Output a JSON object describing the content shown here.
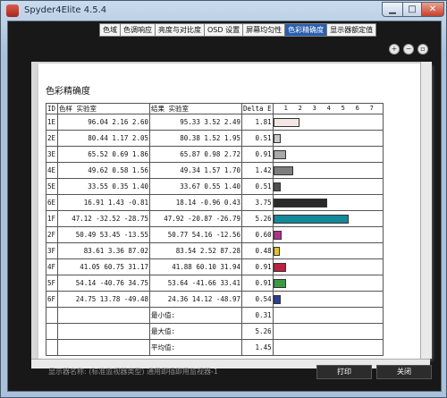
{
  "window": {
    "title": "Spyder4Elite 4.5.4"
  },
  "tabs": [
    "色域",
    "色调响应",
    "亮度与对比度",
    "OSD 设置",
    "屏幕均匀性",
    "色彩精确度",
    "显示器额定值"
  ],
  "active_tab": 5,
  "report": {
    "title": "色彩精确度",
    "headers": {
      "id": "ID",
      "sample": "色样 实验室",
      "result": "结果 实验室",
      "delta": "Delta E"
    },
    "scale_ticks": [
      "1",
      "2",
      "3",
      "4",
      "5",
      "6",
      "7"
    ],
    "rows": [
      {
        "id": "1E",
        "s": [
          "96.04",
          "2.16",
          "2.60"
        ],
        "r": [
          "95.33",
          "3.52",
          "2.49"
        ],
        "d": "1.81",
        "color": "#f4e6e2"
      },
      {
        "id": "2E",
        "s": [
          "80.44",
          "1.17",
          "2.05"
        ],
        "r": [
          "80.38",
          "1.52",
          "1.95"
        ],
        "d": "0.51",
        "color": "#c8c8c8"
      },
      {
        "id": "3E",
        "s": [
          "65.52",
          "0.69",
          "1.86"
        ],
        "r": [
          "65.87",
          "0.98",
          "2.72"
        ],
        "d": "0.91",
        "color": "#a8a8a8"
      },
      {
        "id": "4E",
        "s": [
          "49.62",
          "0.58",
          "1.56"
        ],
        "r": [
          "49.34",
          "1.57",
          "1.70"
        ],
        "d": "1.42",
        "color": "#7d7d7d"
      },
      {
        "id": "5E",
        "s": [
          "33.55",
          "0.35",
          "1.40"
        ],
        "r": [
          "33.67",
          "0.55",
          "1.40"
        ],
        "d": "0.51",
        "color": "#505050"
      },
      {
        "id": "6E",
        "s": [
          "16.91",
          "1.43",
          "-0.81"
        ],
        "r": [
          "18.14",
          "-0.96",
          "0.43"
        ],
        "d": "3.75",
        "color": "#2a2a2a"
      },
      {
        "id": "1F",
        "s": [
          "47.12",
          "-32.52",
          "-28.75"
        ],
        "r": [
          "47.92",
          "-20.87",
          "-26.79"
        ],
        "d": "5.26",
        "color": "#138a9c"
      },
      {
        "id": "2F",
        "s": [
          "50.49",
          "53.45",
          "-13.55"
        ],
        "r": [
          "50.77",
          "54.16",
          "-12.56"
        ],
        "d": "0.60",
        "color": "#b0308e"
      },
      {
        "id": "3F",
        "s": [
          "83.61",
          "3.36",
          "87.02"
        ],
        "r": [
          "83.54",
          "2.52",
          "87.28"
        ],
        "d": "0.48",
        "color": "#e6c02c"
      },
      {
        "id": "4F",
        "s": [
          "41.05",
          "60.75",
          "31.17"
        ],
        "r": [
          "41.88",
          "60.10",
          "31.94"
        ],
        "d": "0.91",
        "color": "#bd2040"
      },
      {
        "id": "5F",
        "s": [
          "54.14",
          "-40.76",
          "34.75"
        ],
        "r": [
          "53.64",
          "-41.66",
          "33.41"
        ],
        "d": "0.91",
        "color": "#3a9a44"
      },
      {
        "id": "6F",
        "s": [
          "24.75",
          "13.78",
          "-49.48"
        ],
        "r": [
          "24.36",
          "14.12",
          "-48.97"
        ],
        "d": "0.54",
        "color": "#2a3f9a"
      }
    ],
    "summary": [
      {
        "label": "最小值:",
        "value": "0.31"
      },
      {
        "label": "最大值:",
        "value": "5.26"
      },
      {
        "label": "平均值:",
        "value": "1.45"
      }
    ]
  },
  "footer": {
    "device_label": "显示器名称: (标准监视器类型) 通用即插即用监视器-1",
    "print_label": "打印",
    "close_label": "关闭"
  }
}
